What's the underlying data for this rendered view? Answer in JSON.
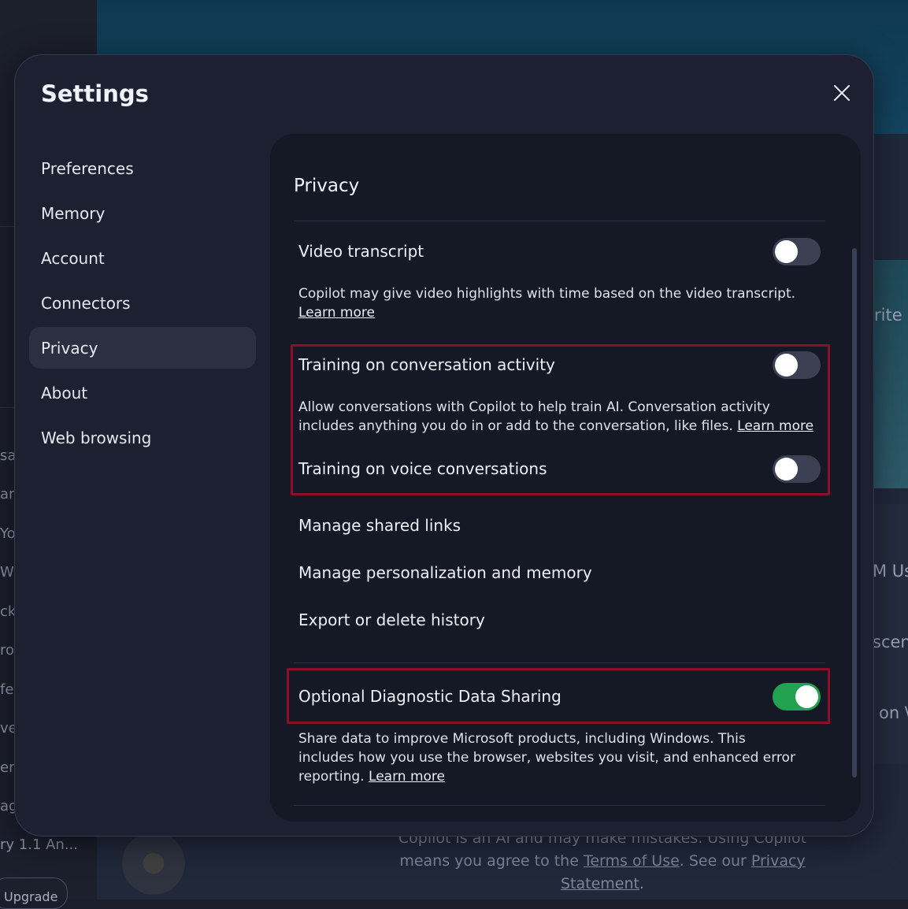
{
  "modal": {
    "title": "Settings",
    "close_icon": "close-icon"
  },
  "nav": {
    "items": [
      {
        "label": "Preferences"
      },
      {
        "label": "Memory"
      },
      {
        "label": "Account"
      },
      {
        "label": "Connectors"
      },
      {
        "label": "Privacy",
        "active": true
      },
      {
        "label": "About"
      },
      {
        "label": "Web browsing"
      }
    ]
  },
  "privacy": {
    "title": "Privacy",
    "video_transcript": {
      "label": "Video transcript",
      "enabled": false,
      "desc": "Copilot may give video highlights with time based on the video transcript.",
      "link": "Learn more"
    },
    "training_conversation": {
      "label": "Training on conversation activity",
      "enabled": false,
      "desc": "Allow conversations with Copilot to help train AI. Conversation activity includes anything you do in or add to the conversation, like files.",
      "link": "Learn more"
    },
    "training_voice": {
      "label": "Training on voice conversations",
      "enabled": false
    },
    "links": {
      "shared_links": "Manage shared links",
      "personalization": "Manage personalization and memory",
      "export": "Export or delete history"
    },
    "diagnostic": {
      "label": "Optional Diagnostic Data Sharing",
      "enabled": true,
      "desc": "Share data to improve Microsoft products, including Windows. This includes how you use the browser, websites you visit, and enhanced error reporting.",
      "link": "Learn more"
    }
  },
  "colors": {
    "toggle_on": "#22a251",
    "toggle_off": "#3b4053",
    "highlight": "#8c0f27"
  },
  "background": {
    "left_fragments": [
      "sag",
      "ari",
      "Yo",
      "Wi",
      "ck",
      "ro",
      "fe",
      "ve",
      "er",
      "ag"
    ],
    "last_item": "ry 1.1 An...",
    "upgrade": "Upgrade",
    "right_fragments": [
      "rite a",
      "M Us",
      "scen",
      "on \\"
    ],
    "footer": {
      "line1": "Copilot is an AI and may make mistakes. Using Copilot",
      "line2a": "means you agree to the ",
      "terms": "Terms of Use",
      "line2b": ". See our ",
      "privacy": "Privacy Statement",
      "end": "."
    }
  }
}
